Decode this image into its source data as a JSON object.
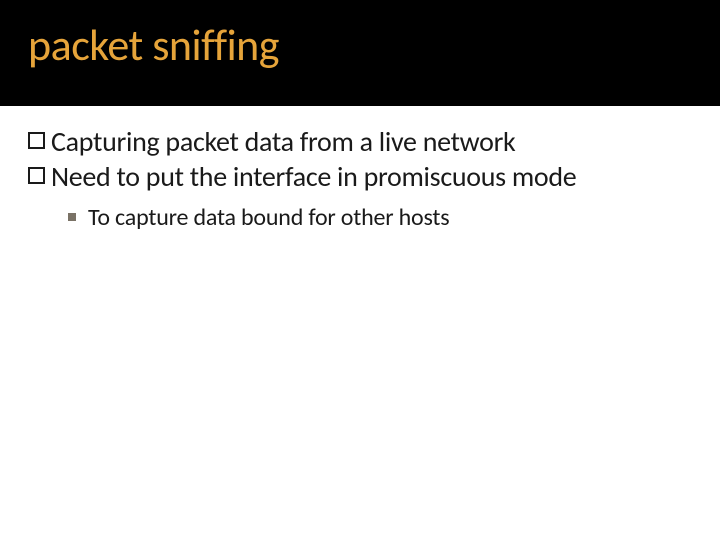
{
  "title": "packet sniffing",
  "bullets": [
    {
      "text": "Capturing packet data from a live network"
    },
    {
      "text": "Need to put the interface in promiscuous mode"
    }
  ],
  "subbullets": [
    {
      "text": "To capture data bound for other hosts"
    }
  ]
}
